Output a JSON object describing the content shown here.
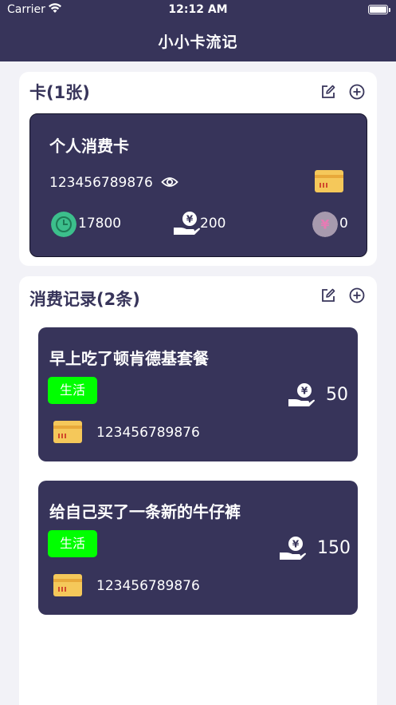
{
  "status_bar": {
    "carrier": "Carrier",
    "time": "12:12 AM"
  },
  "nav": {
    "title": "小小卡流记"
  },
  "cards_section": {
    "title": "卡(1张)",
    "edit_icon": "edit-icon",
    "add_icon": "add-circle-icon",
    "card": {
      "name": "个人消费卡",
      "number": "123456789876",
      "balance": "17800",
      "spent": "200",
      "other": "0"
    }
  },
  "records_section": {
    "title": "消费记录(2条)",
    "records": [
      {
        "title": "早上吃了顿肯德基套餐",
        "tag": "生活",
        "amount": "50",
        "card_number": "123456789876"
      },
      {
        "title": "给自己买了一条新的牛仔裤",
        "tag": "生活",
        "amount": "150",
        "card_number": "123456789876"
      }
    ]
  },
  "colors": {
    "header": "#37345a",
    "card": "#37345a",
    "tag": "#00ff00",
    "background": "#f2f2f7"
  }
}
